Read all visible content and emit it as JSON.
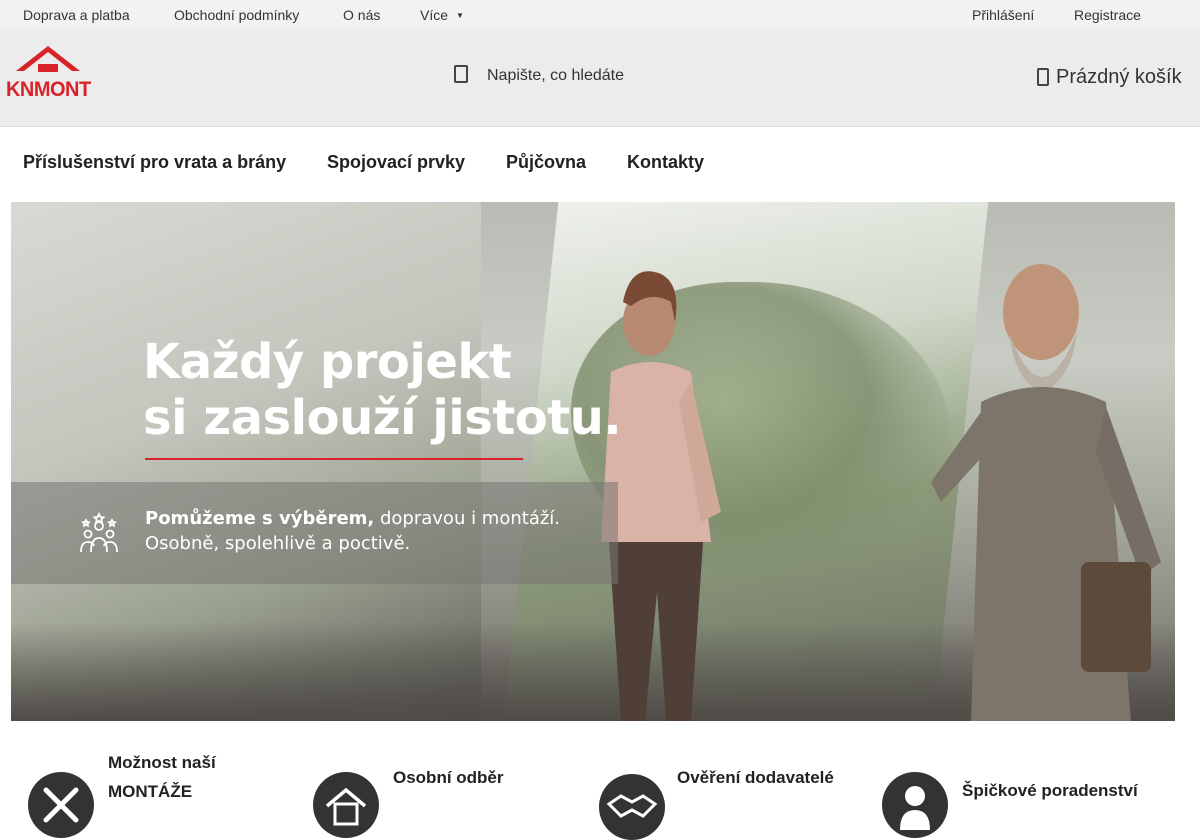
{
  "topbar": {
    "links": [
      "Doprava a platba",
      "Obchodní podmínky",
      "O nás",
      "Více"
    ],
    "login": "Přihlášení",
    "register": "Registrace"
  },
  "header": {
    "logo_text": "KNMONT",
    "search_placeholder": "Napište, co hledáte",
    "cart_label": "Prázdný košík"
  },
  "nav": {
    "items": [
      "Příslušenství pro vrata a brány",
      "Spojovací prvky",
      "Půjčovna",
      "Kontakty"
    ]
  },
  "hero": {
    "title_line1": "Každý projekt",
    "title_line2": "si zaslouží jistotu.",
    "box_bold": "Pomůžeme s výběrem,",
    "box_rest": " dopravou i montáží.",
    "box_line2": "Osobně, spolehlivě a poctivě."
  },
  "features": [
    {
      "line1": "Možnost naší",
      "line2": "MONTÁŽE",
      "icon": "tools-icon"
    },
    {
      "line1": "Osobní odběr",
      "line2": "",
      "icon": "house-icon"
    },
    {
      "line1": "Ověření dodavatelé",
      "line2": "",
      "icon": "handshake-icon"
    },
    {
      "line1": "Špičkové poradenství",
      "line2": "",
      "icon": "person-icon"
    }
  ],
  "colors": {
    "brand_red": "#d8232a",
    "topbar_bg": "#f2f2f2",
    "header_bg": "#ececec",
    "icon_dark": "#333333"
  }
}
